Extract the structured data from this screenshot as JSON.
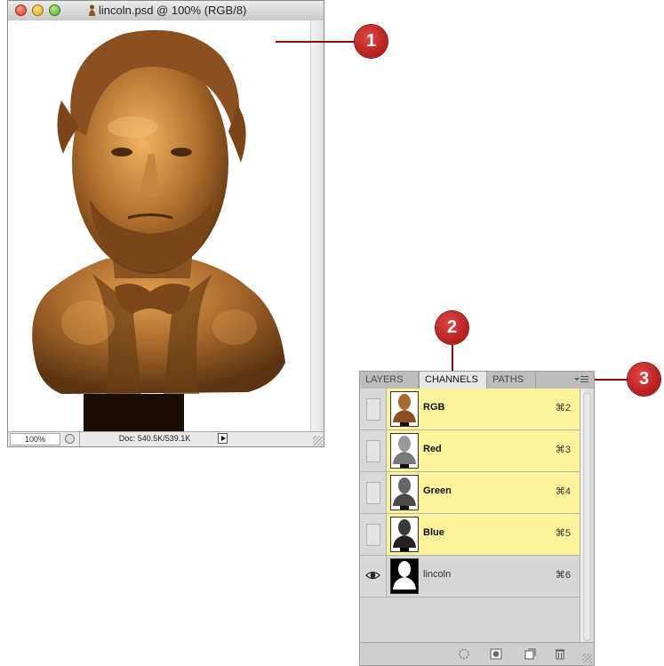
{
  "document_window": {
    "title": "lincoln.psd @ 100% (RGB/8)",
    "zoom": "100%",
    "doc_size": "Doc: 540.5K/539.1K"
  },
  "callouts": [
    "1",
    "2",
    "3"
  ],
  "channels_panel": {
    "tabs": [
      "LAYERS",
      "CHANNELS",
      "PATHS"
    ],
    "active_tab": "CHANNELS",
    "channels": [
      {
        "name": "RGB",
        "shortcut": "⌘2",
        "visible": false,
        "highlighted": true
      },
      {
        "name": "Red",
        "shortcut": "⌘3",
        "visible": false,
        "highlighted": true
      },
      {
        "name": "Green",
        "shortcut": "⌘4",
        "visible": false,
        "highlighted": true
      },
      {
        "name": "Blue",
        "shortcut": "⌘5",
        "visible": false,
        "highlighted": true
      },
      {
        "name": "lincoln",
        "shortcut": "⌘6",
        "visible": true,
        "highlighted": false
      }
    ],
    "footer_icons": [
      "load-selection-icon",
      "save-selection-icon",
      "new-channel-icon",
      "trash-icon"
    ]
  },
  "colors": {
    "callout_red": "#b01515",
    "highlight_yellow": "#fcf39a",
    "bronze": "#a8692c"
  }
}
